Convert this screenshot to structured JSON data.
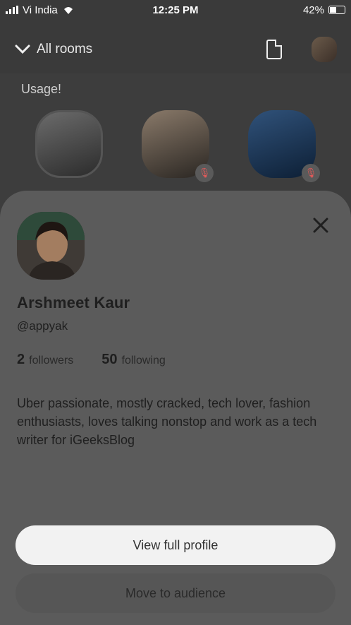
{
  "status_bar": {
    "carrier": "Vi India",
    "time": "12:25 PM",
    "battery": "42%"
  },
  "background": {
    "rooms_label": "All rooms",
    "room_text": "Usage!"
  },
  "profile": {
    "name": "Arshmeet Kaur",
    "handle": "@appyak",
    "followers_count": "2",
    "followers_label": "followers",
    "following_count": "50",
    "following_label": "following",
    "bio": "Uber passionate, mostly cracked, tech lover, fashion enthusiasts, loves talking nonstop and work as a tech writer for iGeeksBlog"
  },
  "actions": {
    "view_profile": "View full profile",
    "move_audience": "Move to audience"
  },
  "icons": [
    "wifi-icon",
    "chevron-down-icon",
    "document-icon",
    "close-icon",
    "mic-muted-icon"
  ]
}
